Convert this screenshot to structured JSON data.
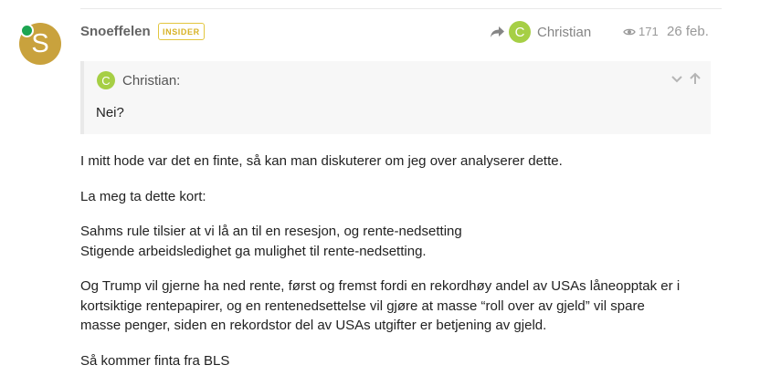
{
  "post": {
    "author": {
      "initial": "S",
      "username": "Snoeffelen",
      "badge": "INSIDER",
      "avatar_color": "#c9a23d",
      "online_color": "#1ca551"
    },
    "reply_to": {
      "initial": "C",
      "name": "Christian",
      "avatar_color": "#a6cf45"
    },
    "views": "171",
    "date": "26 feb.",
    "quote": {
      "initial": "C",
      "author": "Christian:",
      "text": "Nei?"
    },
    "paragraphs": [
      [
        "I mitt hode var det en finte, så kan man diskuterer om jeg over analyserer dette."
      ],
      [
        "La meg ta dette kort:"
      ],
      [
        "Sahms rule tilsier at vi lå an til en resesjon, og rente-nedsetting",
        "Stigende arbeidsledighet ga mulighet til rente-nedsetting."
      ],
      [
        "Og Trump vil gjerne ha ned rente, først og fremst fordi en rekordhøy andel av USAs låneopptak er i",
        "kortsiktige rentepapirer, og en rentenedsettelse vil gjøre at masse “roll over av gjeld” vil spare",
        "masse penger, siden en rekordstor del av USAs utgifter er betjening av gjeld."
      ],
      [
        "Så kommer finta fra BLS"
      ]
    ]
  }
}
